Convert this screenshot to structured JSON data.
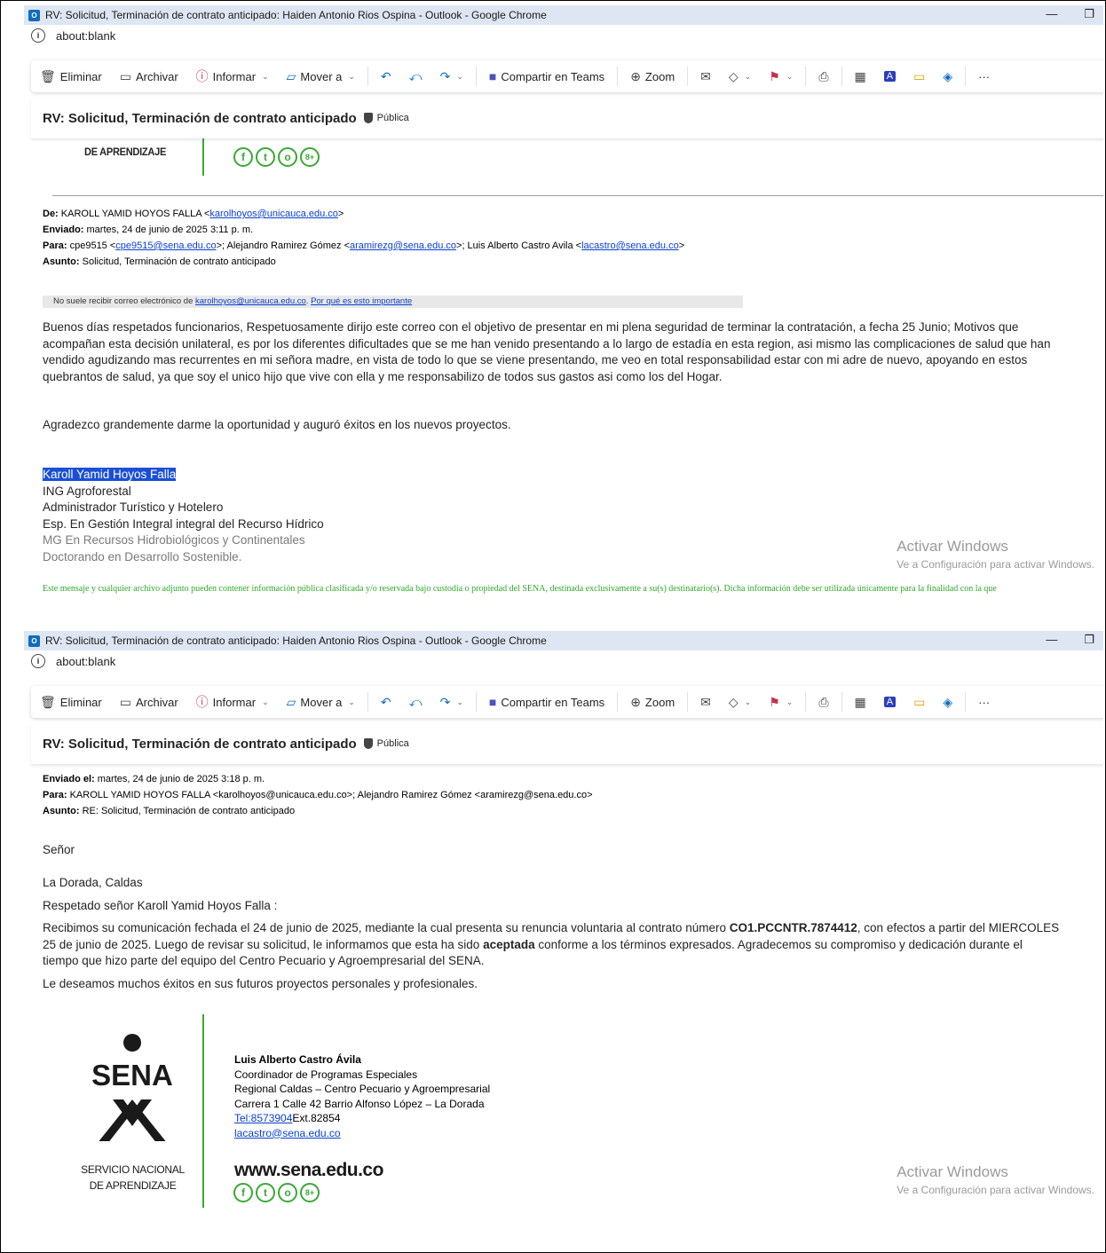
{
  "window": {
    "title": "RV: Solicitud, Terminación de contrato anticipado: Haiden Antonio Rios Ospina - Outlook - Google Chrome",
    "address": "about:blank",
    "outlook_icon": "O"
  },
  "toolbar": {
    "delete": "Eliminar",
    "archive": "Archivar",
    "report": "Informar",
    "move": "Mover a",
    "share_teams": "Compartir en Teams",
    "zoom": "Zoom",
    "more": "···"
  },
  "subject": {
    "title": "RV: Solicitud, Terminación de contrato anticipado",
    "badge": "Pública"
  },
  "sena": {
    "de_aprendizaje": "DE APRENDIZAJE",
    "servicio_nacional": "SERVICIO NACIONAL",
    "logo_text": "SENA",
    "website": "www.sena.edu.co",
    "social": [
      "f",
      "t",
      "o",
      "8+"
    ]
  },
  "email1": {
    "from_label": "De:",
    "from_name": "KAROLL YAMID HOYOS FALLA <",
    "from_email": "karolhoyos@unicauca.edu.co",
    "from_end": ">",
    "sent_label": "Enviado:",
    "sent": "martes, 24 de junio de 2025 3:11 p. m.",
    "to_label": "Para:",
    "to_1": "cpe9515 <",
    "to_1_email": "cpe9515@sena.edu.co",
    "to_2": ">; Alejandro Ramirez Gómez <",
    "to_2_email": "aramirezg@sena.edu.co",
    "to_3": ">; Luis Alberto Castro Avila <",
    "to_3_email": "lacastro@sena.edu.co",
    "to_end": ">",
    "subject_label": "Asunto:",
    "subject": "Solicitud, Terminación de contrato anticipado",
    "warning_prefix": "No suele recibir correo electrónico de ",
    "warning_email": "karolhoyos@unicauca.edu.co",
    "warning_link": "Por qué es esto importante",
    "body_lines": [
      "Buenos días respetados funcionarios, Respetuosamente dirijo este correo con el objetivo de presentar en mi plena seguridad de terminar la contratación, a fecha 25 Junio; Motivos que",
      "acompañan esta decisión unilateral, es por los diferentes dificultades que se me han venido presentando a lo largo de estadía en esta region, asi mismo las complicaciones de salud que han",
      "vendido agudizando mas recurrentes en mi señora madre, en vista de todo lo que se viene presentando, me veo en total responsabilidad estar con  mi adre de nuevo,  apoyando en estos",
      "quebrantos de salud, ya que soy el unico hijo que vive con ella  y me responsabilizo de todos sus gastos asi como los del Hogar."
    ],
    "thanks": "Agradezco grandemente darme la oportunidad y auguró éxitos en los nuevos proyectos.",
    "signature_name": "Karoll Yamid Hoyos Falla",
    "signature_lines": [
      "ING Agroforestal",
      "Administrador Turístico y Hotelero",
      "Esp. En Gestión Integral integral del Recurso Hídrico"
    ],
    "signature_lines_grey": [
      "MG En Recursos Hidrobiológicos y Continentales",
      "Doctorando en Desarrollo Sostenible."
    ],
    "disclaimer": "Este mensaje y cualquier archivo adjunto pueden contener información pública clasificada y/o reservada bajo custodia o propiedad del SENA, destinada exclusivamente a su(s) destinatario(s). Dicha información debe ser utilizada únicamente para la finalidad con la que"
  },
  "email2": {
    "sent_label": "Enviado el:",
    "sent": "martes, 24 de junio de 2025 3:18 p. m.",
    "to_label": "Para:",
    "to": "KAROLL YAMID HOYOS FALLA <karolhoyos@unicauca.edu.co>; Alejandro Ramirez Gómez <aramirezg@sena.edu.co>",
    "subject_label": "Asunto:",
    "subject": "RE: Solicitud, Terminación de contrato anticipado",
    "greeting": "Señor",
    "location": "La Dorada, Caldas",
    "salutation": "Respetado señor Karoll Yamid Hoyos Falla :",
    "p1_a": "Recibimos su comunicación fechada el 24 de junio de 2025, mediante la cual presenta su renuncia voluntaria al contrato número ",
    "p1_contract": "CO1.PCCNTR.7874412",
    "p1_b": ", con efectos a partir del MIERCOLES",
    "p1_c": "25 de junio de 2025. Luego de revisar su solicitud, le informamos que esta ha sido ",
    "p1_accepted": "aceptada",
    "p1_d": " conforme a los términos expresados. Agradecemos su compromiso y dedicación durante el",
    "p1_e": "tiempo que hizo parte del equipo del Centro Pecuario y Agroempresarial del SENA.",
    "p2": "Le deseamos muchos éxitos en sus futuros proyectos personales y profesionales.",
    "sig_name": "Luis Alberto Castro Ávila",
    "sig_role": "Coordinador de Programas Especiales",
    "sig_regional": "Regional Caldas – Centro Pecuario y Agroempresarial",
    "sig_address": "Carrera 1 Calle 42 Barrio Alfonso López – La Dorada",
    "sig_tel_link": "Tel:8573904",
    "sig_tel_ext": "Ext.82854",
    "sig_email": "lacastro@sena.edu.co"
  },
  "activate_windows": {
    "title": "Activar Windows",
    "subtitle": "Ve a Configuración para activar Windows."
  },
  "colors": {
    "accent": "#0f6cbd",
    "sena_green": "#39a935",
    "selection": "#1a4fd6"
  }
}
